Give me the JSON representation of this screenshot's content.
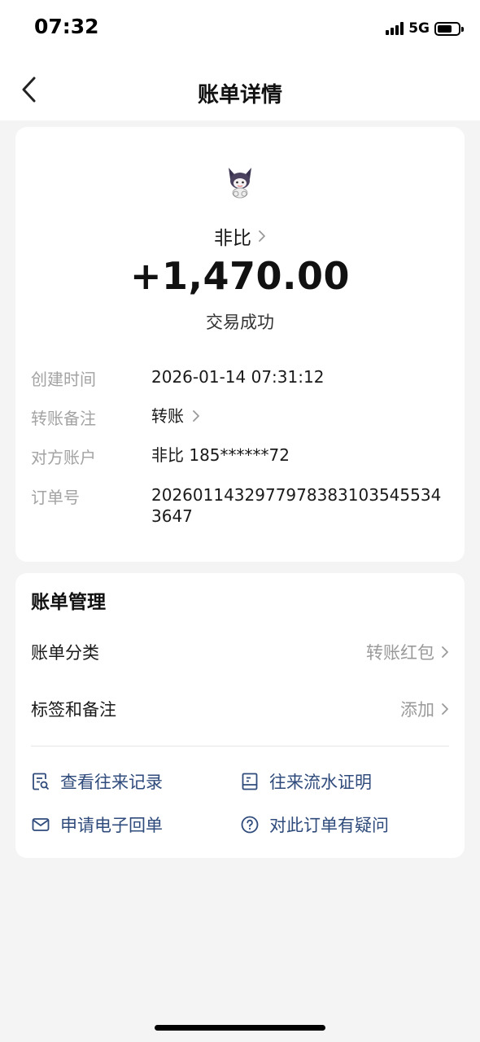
{
  "status_bar": {
    "time": "07:32",
    "network": "5G",
    "battery_level": 0.7
  },
  "nav": {
    "title": "账单详情"
  },
  "summary": {
    "payee": "非比",
    "amount": "+1,470.00",
    "status": "交易成功",
    "details": [
      {
        "label": "创建时间",
        "value": "2026-01-14 07:31:12"
      },
      {
        "label": "转账备注",
        "value": "转账"
      },
      {
        "label": "对方账户",
        "value": "非比 185******72"
      },
      {
        "label": "订单号",
        "value": "2026011432977978383103545534 3647"
      }
    ]
  },
  "manage": {
    "title": "账单管理",
    "category_label": "账单分类",
    "category_value": "转账红包",
    "tags_label": "标签和备注",
    "tags_value": "添加",
    "actions": [
      {
        "label": "查看往来记录",
        "icon": "records-search-icon"
      },
      {
        "label": "往来流水证明",
        "icon": "statement-icon"
      },
      {
        "label": "申请电子回单",
        "icon": "mail-icon"
      },
      {
        "label": "对此订单有疑问",
        "icon": "question-icon"
      }
    ]
  },
  "colors": {
    "accent": "#2f4b7c",
    "muted": "#a3a3a3",
    "background": "#f4f4f4"
  }
}
